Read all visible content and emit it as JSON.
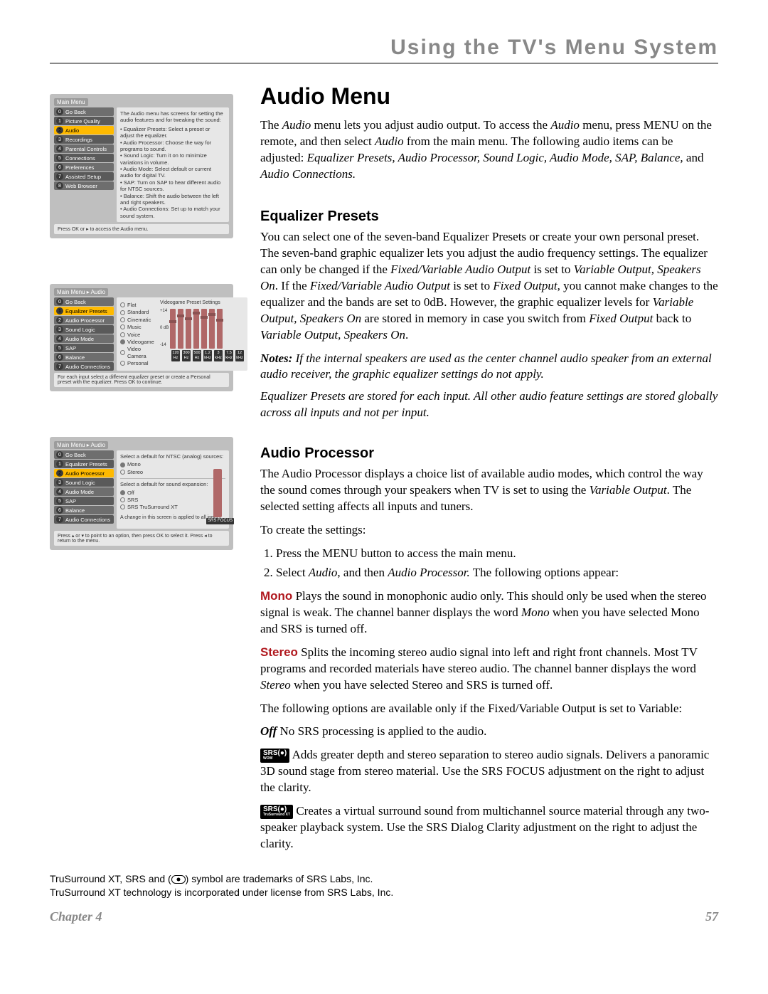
{
  "header": {
    "title": "Using the TV's Menu System"
  },
  "h1": "Audio Menu",
  "intro": {
    "p1a": "The ",
    "p1b": "Audio",
    "p1c": " menu lets you adjust audio output. To access the ",
    "p1d": "Audio",
    "p1e": " menu, press MENU on the remote, and then select ",
    "p1f": "Audio",
    "p1g": " from the main menu. The following audio items can be adjusted: ",
    "p1h": "Equalizer Presets, Audio Processor, Sound Logic, Audio Mode, SAP,  Balance,",
    "p1i": " and ",
    "p1j": "Audio Connections."
  },
  "eq": {
    "h2": "Equalizer Presets",
    "p1a": "You can select one of the seven-band Equalizer Presets or create your own personal preset. The seven-band graphic equalizer lets you adjust the audio frequency settings. The equalizer can only be changed if the ",
    "p1b": "Fixed/Variable Audio Output",
    "p1c": " is set to ",
    "p1d": "Variable Output, Speakers On",
    "p1e": ". If the ",
    "p1f": "Fixed/Variable Audio Output",
    "p1g": " is set to ",
    "p1h": "Fixed Output",
    "p1i": ", you cannot make changes to the equalizer and the bands are set to 0dB. However, the graphic equalizer levels for ",
    "p1j": "Variable Output, Speakers On",
    "p1k": " are stored in memory in case you switch from ",
    "p1l": "Fixed Output",
    "p1m": " back to ",
    "p1n": "Variable Output, Speakers On",
    "p1o": ".",
    "note1a": "Notes:",
    "note1b": " If the internal speakers are used as the center channel audio speaker from an external audio receiver, the graphic equalizer settings do not apply.",
    "note2": "Equalizer Presets are stored for each input. All other audio feature settings are stored globally across all inputs and not per input."
  },
  "ap": {
    "h2": "Audio Processor",
    "p1a": "The Audio Processor displays a choice list of available audio modes, which control the way the sound comes through your speakers when TV is set to using the ",
    "p1b": "Variable Output",
    "p1c": ". The selected setting affects all inputs and tuners.",
    "p2": "To create the settings:",
    "step1": "Press the MENU button to access the main menu.",
    "step2a": "Select ",
    "step2b": "Audio",
    "step2c": ", and then ",
    "step2d": "Audio Processor.",
    "step2e": " The following options appear:",
    "mono_label": "Mono",
    "mono_a": "   Plays the sound in monophonic audio only. This should only be used when the stereo signal is weak. The channel banner displays the word ",
    "mono_b": "Mono",
    "mono_c": " when you have selected Mono and SRS is turned off.",
    "stereo_label": "Stereo",
    "stereo_a": "   Splits the incoming stereo audio signal into left and right front channels. Most TV programs and recorded materials have stereo audio. The channel banner displays the word ",
    "stereo_b": "Stereo",
    "stereo_c": " when you have selected Stereo and SRS is turned off.",
    "p3": "The following options are available only if the Fixed/Variable Output is set to Variable:",
    "off_label": "Off",
    "off_text": "   No SRS processing is applied to the audio.",
    "srs_text": "   Adds greater depth and stereo separation to stereo audio signals. Delivers a panoramic 3D sound stage from stereo material. Use the SRS FOCUS adjustment on the right to adjust the clarity.",
    "ts_text": "   Creates a virtual surround sound from multichannel source material through any two-speaker playback system. Use the SRS Dialog Clarity adjustment on the right to adjust the clarity."
  },
  "trademark": {
    "line1a": "TruSurround XT, SRS and (",
    "line1b": ") symbol are trademarks of SRS Labs, Inc.",
    "line2": "TruSurround XT technology is incorporated under license from SRS Labs, Inc."
  },
  "footer": {
    "chapter": "Chapter 4",
    "page": "57"
  },
  "shot1": {
    "breadcrumb": "Main Menu",
    "menu": [
      "Go Back",
      "Picture Quality",
      "Audio",
      "Recordings",
      "Parental Controls",
      "Connections",
      "Preferences",
      "Assisted Setup",
      "Web Browser"
    ],
    "hl_index": 2,
    "body_intro": "The Audio menu has screens for setting the audio features and for tweaking the sound:",
    "bullets": [
      "Equalizer Presets: Select a preset or adjust the equalizer.",
      "Audio Processor: Choose the way for programs to sound.",
      "Sound Logic: Turn it on to minimize variations in volume.",
      "Audio Mode: Select default or current audio for digital TV.",
      "SAP: Turn on SAP to hear different audio for NTSC sources.",
      "Balance: Shift the audio between the left and right speakers.",
      "Audio Connections: Set up to match your sound system."
    ],
    "foot": "Press OK or ▸ to access the Audio menu."
  },
  "shot2": {
    "breadcrumb": "Main Menu ▸ Audio",
    "menu": [
      "Go Back",
      "Equalizer Presets",
      "Audio Processor",
      "Sound Logic",
      "Audio Mode",
      "SAP",
      "Balance",
      "Audio Connections"
    ],
    "hl_index": 1,
    "presets": [
      "Flat",
      "Standard",
      "Cinematic",
      "Music",
      "Voice",
      "Videogame",
      "Video Camera",
      "Personal"
    ],
    "title": "Videogame Preset Settings",
    "bands": [
      "120 Hz",
      "300 Hz",
      "500 Hz",
      "1.2 kHz",
      "3 kHz",
      "7.5 kHz",
      "12 kHz"
    ],
    "foot": "For each input select a different equalizer preset or create a Personal preset with the equalizer. Press OK to continue."
  },
  "shot3": {
    "breadcrumb": "Main Menu ▸ Audio",
    "menu": [
      "Go Back",
      "Equalizer Presets",
      "Audio Processor",
      "Sound Logic",
      "Audio Mode",
      "SAP",
      "Balance",
      "Audio Connections"
    ],
    "hl_index": 2,
    "sec1_title": "Select a default for NTSC (analog) sources:",
    "sec1_opts": [
      "Mono",
      "Stereo"
    ],
    "sec2_title": "Select a default for sound expansion:",
    "sec2_opts": [
      "Off",
      "SRS",
      "SRS TruSurround XT"
    ],
    "chg": "A change in this screen is applied to all inputs.",
    "foot": "Press ▴ or ▾ to point to an option, then press OK to select it. Press ◂ to return to the menu."
  },
  "logos": {
    "srs_top": "SRS(●)",
    "srs_sub1": "WOW",
    "ts_top": "SRS(●)",
    "ts_sub": "TruSurround XT"
  }
}
